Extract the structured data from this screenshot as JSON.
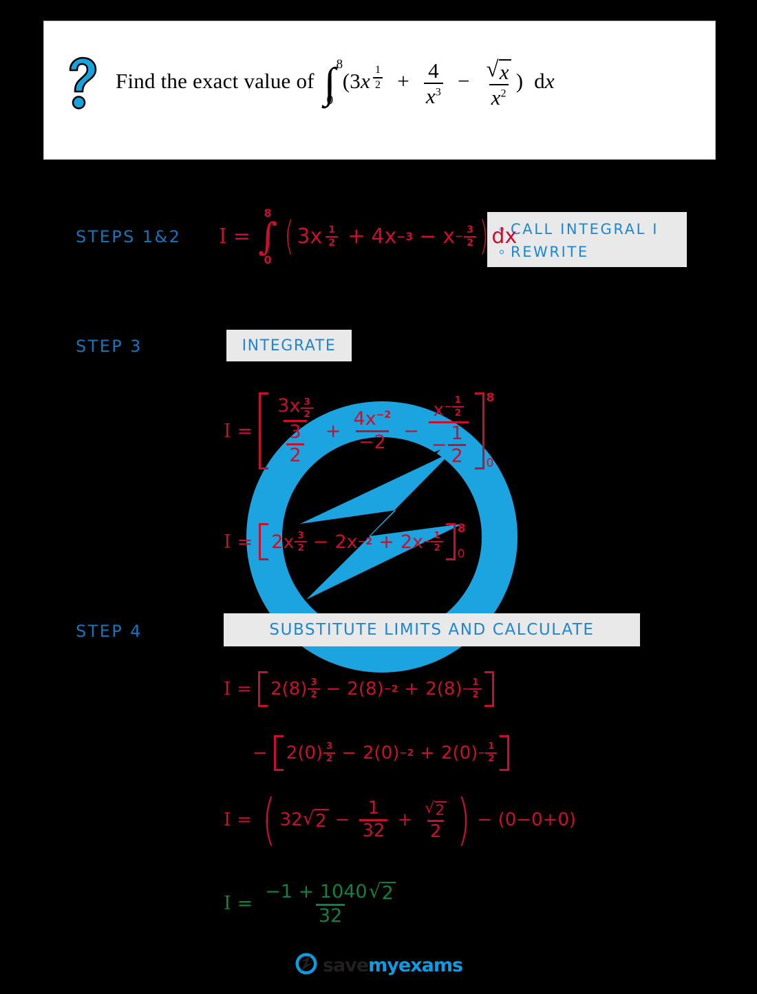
{
  "page": {
    "background": "#000000",
    "accent_blue": "#1276bd",
    "bright_blue": "#0e9ce0",
    "work_red": "#c8102e",
    "answer_green": "#118040",
    "box_grey": "#e9e9e9"
  },
  "question": {
    "icon": "question-mark-icon",
    "prompt": "Find the exact value of",
    "integral": {
      "upper_limit": "8",
      "lower_limit": "0",
      "integrand_plain": "(3x^(1/2) + 4/x^3 - sqrt(x)/x^2)",
      "terms": {
        "term1_coef": "3",
        "term1_var": "x",
        "term1_exp_num": "1",
        "term1_exp_den": "2",
        "op1": "+",
        "term2_num": "4",
        "term2_den_var": "x",
        "term2_den_exp": "3",
        "op2": "−",
        "term3_num_var": "x",
        "term3_den_var": "x",
        "term3_den_exp": "2"
      },
      "differential": "d",
      "differential_var": "x",
      "open_paren": "(",
      "close_paren": ")"
    }
  },
  "steps": [
    {
      "label": "STEPS 1&2"
    },
    {
      "label": "STEP 3"
    },
    {
      "label": "STEP 4"
    }
  ],
  "callout": {
    "items": [
      "CALL  INTEGRAL  I",
      "REWRITE"
    ]
  },
  "integrate_box": {
    "label": "INTEGRATE"
  },
  "substitute_box": {
    "label": "SUBSTITUTE  LIMITS  AND  CALCULATE"
  },
  "work": {
    "line1": {
      "lhs": "I",
      "eq": "=",
      "upper_limit": "8",
      "lower_limit": "0",
      "t1_coef": "3",
      "t1_var": "x",
      "t1_exp_n": "1",
      "t1_exp_d": "2",
      "op1": "+",
      "t2_coef": "4",
      "t2_var": "x",
      "t2_exp": "−3",
      "op2": "−",
      "t3_var": "x",
      "t3_exp_sign": "−",
      "t3_exp_n": "3",
      "t3_exp_d": "2",
      "dx": "dx"
    },
    "line2": {
      "lhs": "I",
      "eq": "=",
      "f1_num_coef": "3",
      "f1_num_var": "x",
      "f1_num_exp_n": "3",
      "f1_num_exp_d": "2",
      "f1_den_n": "3",
      "f1_den_d": "2",
      "op1": "+",
      "f2_num_coef": "4",
      "f2_num_var": "x",
      "f2_num_exp": "−2",
      "f2_den": "−2",
      "op2": "−",
      "f3_num_var": "x",
      "f3_num_exp_sign": "−",
      "f3_num_exp_n": "1",
      "f3_num_exp_d": "2",
      "f3_den_sign": "−",
      "f3_den_n": "1",
      "f3_den_d": "2",
      "upper_limit": "8",
      "lower_limit": "0"
    },
    "line3": {
      "lhs": "I",
      "eq": "=",
      "t1": "2x",
      "t1_exp_n": "3",
      "t1_exp_d": "2",
      "op1": "−",
      "t2": "2x",
      "t2_exp": "−2",
      "op2": "+",
      "t3": "2x",
      "t3_exp_sign": "−",
      "t3_exp_n": "1",
      "t3_exp_d": "2",
      "upper_limit": "8",
      "lower_limit": "0"
    },
    "line4": {
      "lhs": "I",
      "eq": "=",
      "t1": "2(8)",
      "t1_exp_n": "3",
      "t1_exp_d": "2",
      "op1": "−",
      "t2": "2(8)",
      "t2_exp": "−2",
      "op2": "+",
      "t3": "2(8)",
      "t3_exp_sign": "−",
      "t3_exp_n": "1",
      "t3_exp_d": "2"
    },
    "line5": {
      "minus": "−",
      "t1": "2(0)",
      "t1_exp_n": "3",
      "t1_exp_d": "2",
      "op1": "−",
      "t2": "2(0)",
      "t2_exp": "−2",
      "op2": "+",
      "t3": "2(0)",
      "t3_exp_sign": "−",
      "t3_exp_n": "1",
      "t3_exp_d": "2"
    },
    "line6": {
      "lhs": "I",
      "eq": "=",
      "a_coef": "32",
      "a_radicand": "2",
      "op1": "−",
      "b_num": "1",
      "b_den": "32",
      "op2": "+",
      "c_num_radicand": "2",
      "c_den": "2",
      "tail": "− (0−0+0)"
    },
    "answer": {
      "lhs": "I",
      "eq": "=",
      "num_lead": "−1 + 1040",
      "num_radicand": "2",
      "den": "32"
    }
  },
  "footer": {
    "logo_icon": "save-my-exams-bolt-icon",
    "text_dark": "save",
    "text_blue": "myexams"
  },
  "watermark": {
    "icon": "circular-arrow-bolt-watermark",
    "color": "#1CA4E0"
  }
}
